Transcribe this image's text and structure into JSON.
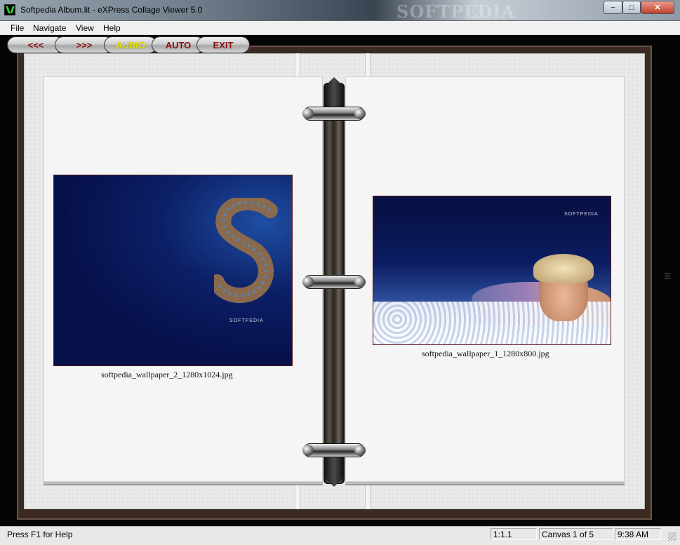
{
  "window": {
    "title": "Softpedia Album.lit - eXPress Collage Viewer 5.0",
    "watermark": "SOFTPEDIA",
    "controls": {
      "minimize": "−",
      "maximize": "□",
      "close": "✕"
    }
  },
  "menu": {
    "items": [
      "File",
      "Navigate",
      "View",
      "Help"
    ]
  },
  "toolbar": {
    "prev": "<<<",
    "next": ">>>",
    "audio": "AUDIO",
    "auto": "AUTO",
    "exit": "EXIT"
  },
  "album": {
    "left": {
      "caption": "softpedia_wallpaper_2_1280x1024.jpg",
      "photo_text": "SOFTPEDIA"
    },
    "right": {
      "caption": "softpedia_wallpaper_1_1280x800.jpg",
      "photo_text": "SOFTPEDIA"
    }
  },
  "status": {
    "help": "Press F1 for Help",
    "zoom": "1:1.1",
    "canvas": "Canvas 1 of 5",
    "time": "9:38 AM"
  },
  "colors": {
    "toolbar_text": "#8b1010",
    "audio_active": "#e6e000",
    "background": "#050505"
  }
}
